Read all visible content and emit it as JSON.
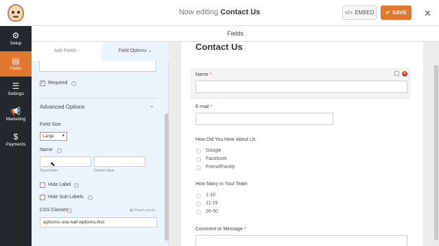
{
  "header": {
    "editing_prefix": "Now editing",
    "form_name": "Contact Us",
    "embed_label": "EMBED",
    "save_label": "SAVE",
    "embed_icon": "code-icon",
    "save_icon": "checkmark-icon"
  },
  "sidebar": {
    "items": [
      {
        "label": "Setup",
        "icon": "gear-icon"
      },
      {
        "label": "Fields",
        "icon": "fields-icon"
      },
      {
        "label": "Settings",
        "icon": "sliders-icon"
      },
      {
        "label": "Marketing",
        "icon": "megaphone-icon"
      },
      {
        "label": "Payments",
        "icon": "dollar-icon"
      }
    ],
    "active": "Fields"
  },
  "section_title": "Fields",
  "panel": {
    "tab_add": "Add Fields",
    "tab_options": "Field Options",
    "required_label": "Required",
    "required_checked": true,
    "advanced_title": "Advanced Options",
    "field_size_label": "Field Size",
    "field_size_value": "Large",
    "name_label": "Name",
    "placeholder_sub": "Placeholder",
    "default_sub": "Default Value",
    "hide_label": "Hide Label",
    "hide_sublabels": "Hide Sub-Labels",
    "css_classes_label": "CSS Classes",
    "show_layouts": "Show Layouts",
    "css_classes_value": "wpforms-one-half wpforms-first"
  },
  "preview": {
    "title": "Contact Us",
    "fields": [
      {
        "label": "Name",
        "required": "*"
      },
      {
        "label": "E-mail",
        "required": "*"
      },
      {
        "label": "How Did You Hear About Us",
        "options": [
          "Google",
          "Facebook",
          "Friend/Family"
        ]
      },
      {
        "label": "How Many In Your Team",
        "options": [
          "1-10",
          "11-25",
          "26-50"
        ]
      },
      {
        "label": "Comment or Message",
        "required": "*"
      }
    ]
  },
  "colors": {
    "accent": "#e27730",
    "sidebar_bg": "#23282d",
    "panel_bg": "#ebf3fc",
    "required": "#d63638"
  }
}
